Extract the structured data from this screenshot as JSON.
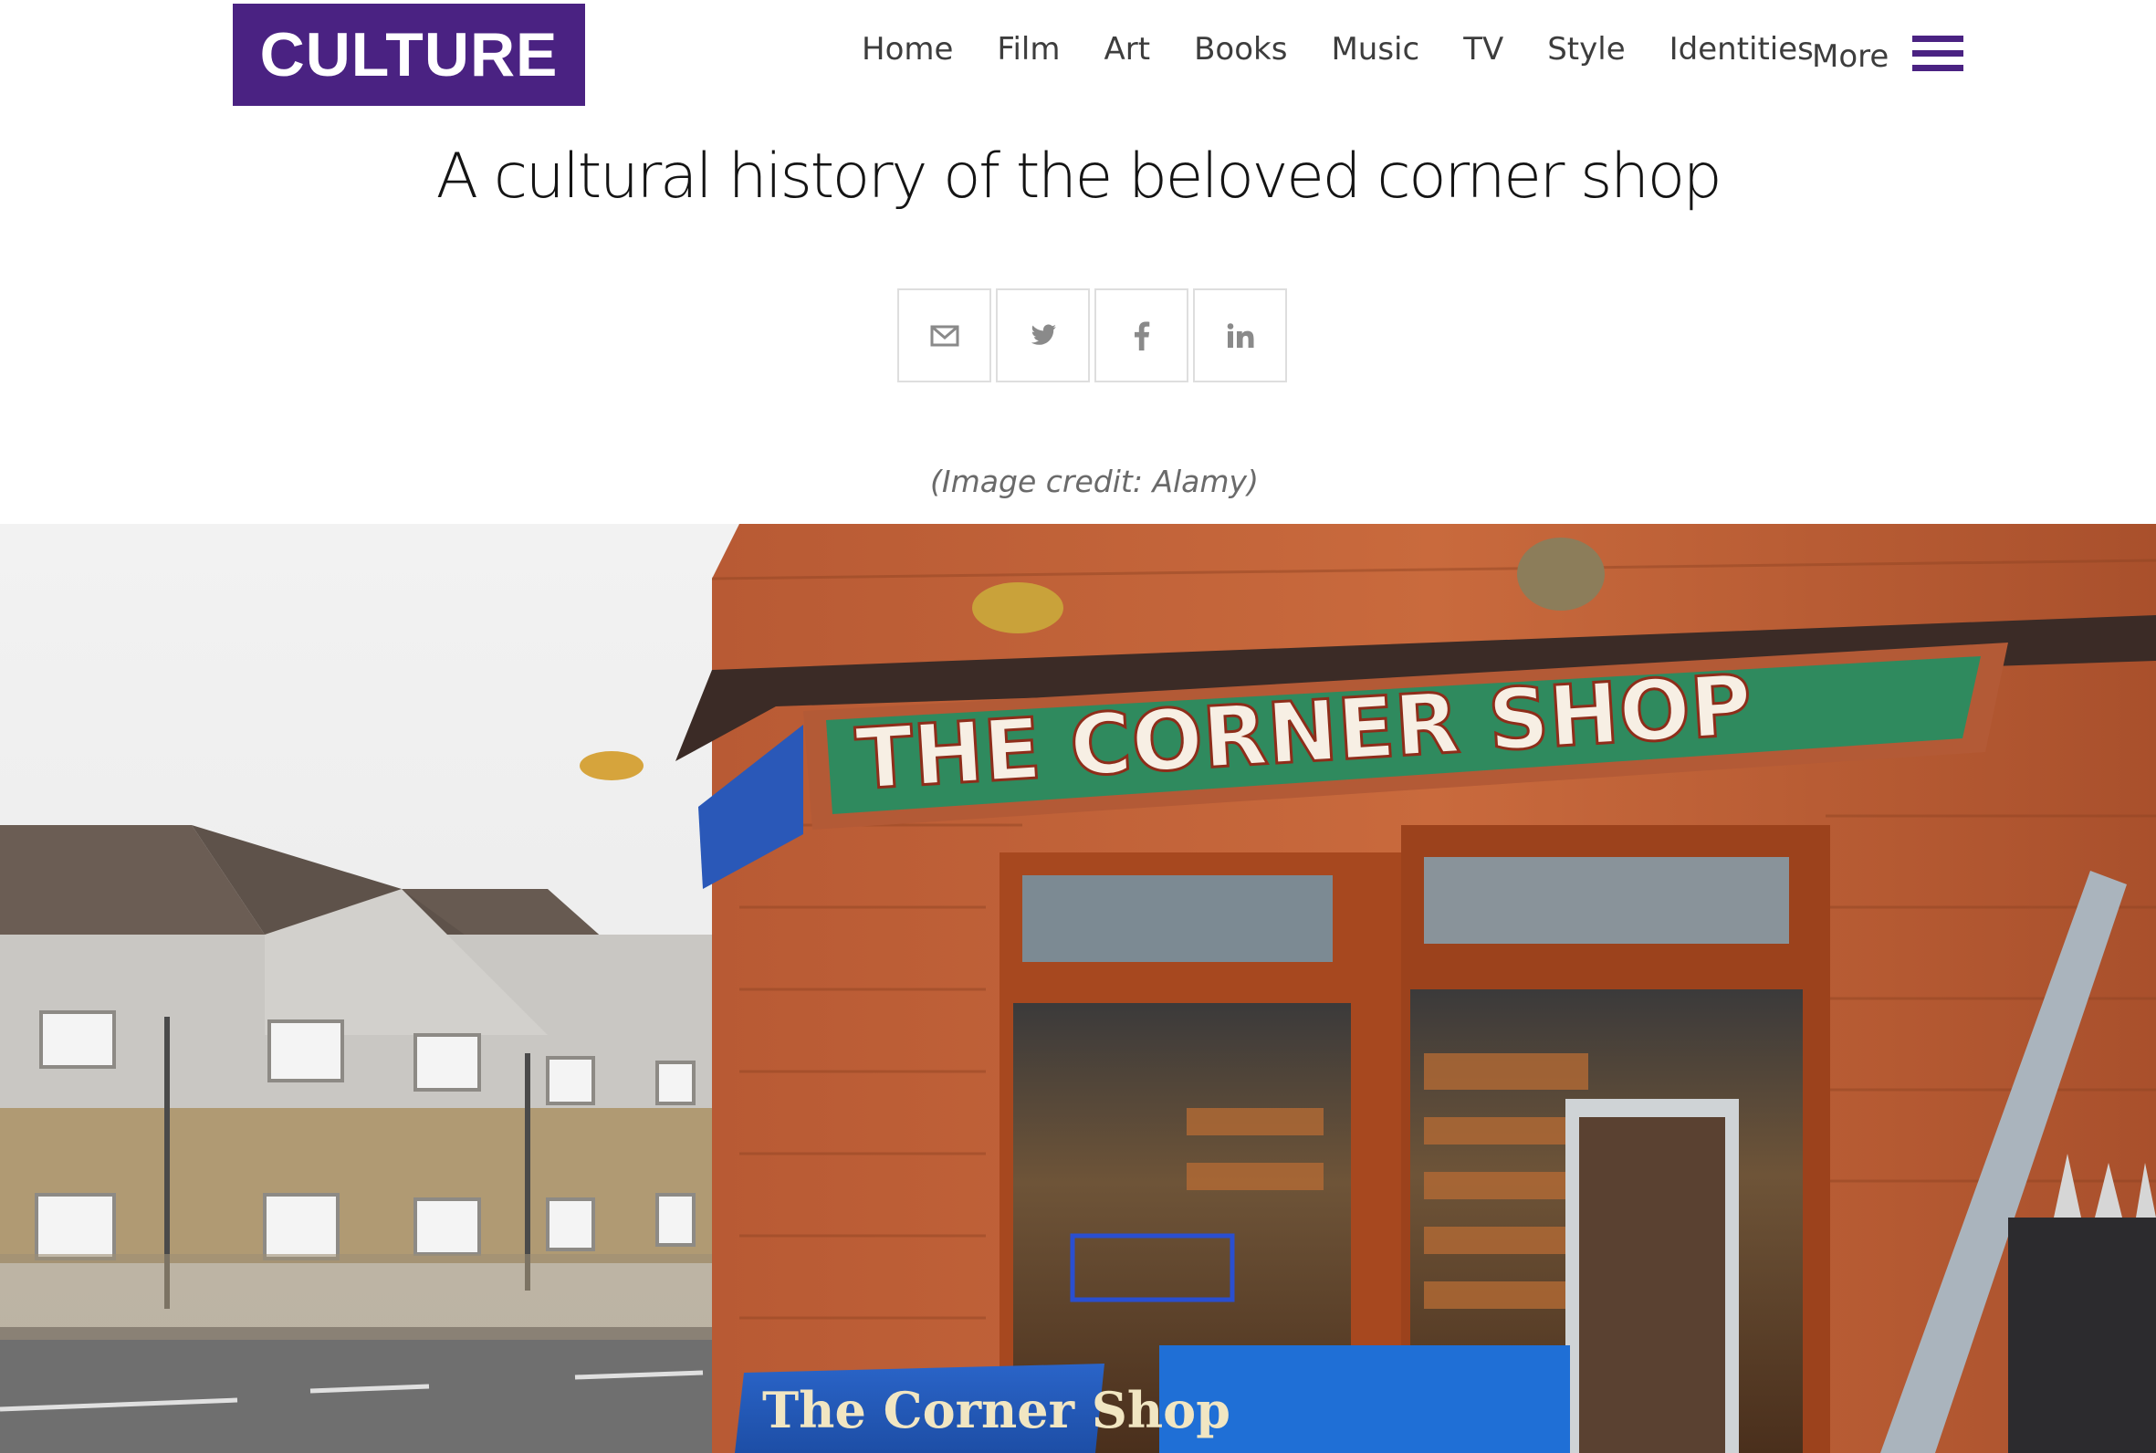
{
  "header": {
    "logo_text": "CULTURE",
    "brand_color": "#4a2282",
    "nav": [
      "Home",
      "Film",
      "Art",
      "Books",
      "Music",
      "TV",
      "Style",
      "Identities"
    ],
    "more_label": "More"
  },
  "article": {
    "title": "A cultural history of the beloved corner shop",
    "share_buttons": [
      "email-icon",
      "twitter-icon",
      "facebook-icon",
      "linkedin-icon"
    ],
    "image_credit": "(Image credit: Alamy)"
  },
  "hero_image": {
    "shop_sign": "THE CORNER SHOP",
    "aframe_sign": "The Corner Shop"
  }
}
